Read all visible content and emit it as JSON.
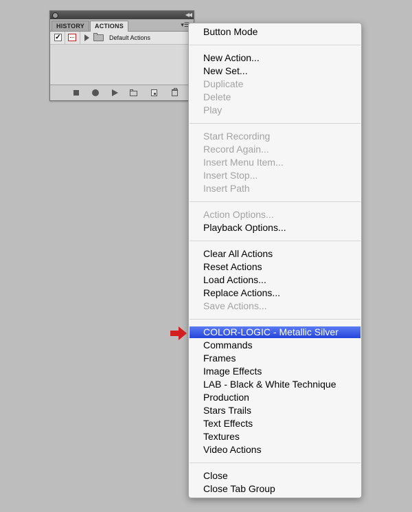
{
  "panel": {
    "tabs": [
      {
        "label": "HISTORY",
        "active": false
      },
      {
        "label": "ACTIONS",
        "active": true
      }
    ],
    "action_sets": [
      {
        "name": "Default Actions",
        "checked": true,
        "dialog": true,
        "expanded": false
      }
    ]
  },
  "menu": {
    "groups": [
      [
        {
          "label": "Button Mode",
          "disabled": false
        }
      ],
      [
        {
          "label": "New Action...",
          "disabled": false
        },
        {
          "label": "New Set...",
          "disabled": false
        },
        {
          "label": "Duplicate",
          "disabled": true
        },
        {
          "label": "Delete",
          "disabled": true
        },
        {
          "label": "Play",
          "disabled": true
        }
      ],
      [
        {
          "label": "Start Recording",
          "disabled": true
        },
        {
          "label": "Record Again...",
          "disabled": true
        },
        {
          "label": "Insert Menu Item...",
          "disabled": true
        },
        {
          "label": "Insert Stop...",
          "disabled": true
        },
        {
          "label": "Insert Path",
          "disabled": true
        }
      ],
      [
        {
          "label": "Action Options...",
          "disabled": true
        },
        {
          "label": "Playback Options...",
          "disabled": false
        }
      ],
      [
        {
          "label": "Clear All Actions",
          "disabled": false
        },
        {
          "label": "Reset Actions",
          "disabled": false
        },
        {
          "label": "Load Actions...",
          "disabled": false
        },
        {
          "label": "Replace Actions...",
          "disabled": false
        },
        {
          "label": "Save Actions...",
          "disabled": true
        }
      ],
      [
        {
          "label": "COLOR-LOGIC - Metallic Silver",
          "disabled": false,
          "selected": true
        },
        {
          "label": "Commands",
          "disabled": false
        },
        {
          "label": "Frames",
          "disabled": false
        },
        {
          "label": "Image Effects",
          "disabled": false
        },
        {
          "label": "LAB - Black & White Technique",
          "disabled": false
        },
        {
          "label": "Production",
          "disabled": false
        },
        {
          "label": "Stars Trails",
          "disabled": false
        },
        {
          "label": "Text Effects",
          "disabled": false
        },
        {
          "label": "Textures",
          "disabled": false
        },
        {
          "label": "Video Actions",
          "disabled": false
        }
      ],
      [
        {
          "label": "Close",
          "disabled": false
        },
        {
          "label": "Close Tab Group",
          "disabled": false
        }
      ]
    ]
  },
  "colors": {
    "highlight": "#2f4fe0",
    "arrow": "#d21f1f",
    "background": "#bdbdbd"
  }
}
